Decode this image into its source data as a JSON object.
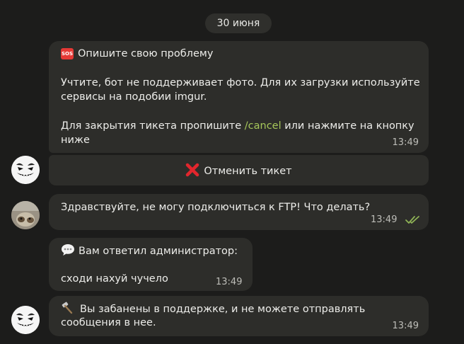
{
  "date_label": "30 июня",
  "messages": {
    "intro": {
      "title": "Опишите свою проблему",
      "line1": "Учтите, бот не поддерживает фото. Для их загрузки используйте",
      "line2": "сервисы на подобии imgur.",
      "line3_prefix": " Для закрытия тикета пропишите ",
      "line3_command": "/cancel",
      "line3_suffix": " или нажмите на кнопку",
      "line4": "ниже",
      "time": "13:49"
    },
    "cancel_button": {
      "label": "Отменить тикет"
    },
    "user_msg": {
      "text": "Здравствуйте, не могу подключиться к FTP! Что делать?",
      "time": "13:49"
    },
    "admin_reply": {
      "title": "Вам ответил администратор:",
      "text": "сходи нахуй чучело",
      "time": "13:49"
    },
    "ban_notice": {
      "line1": "Вы забанены в поддержке, и не можете отправлять",
      "line2": "сообщения в нее.",
      "time": "13:49"
    }
  },
  "colors": {
    "background": "#1c1c1b",
    "bubble": "#2d2d2a",
    "command": "#a6c75a",
    "read_checks": "#8fb356",
    "sos": "#e53935"
  },
  "icons": {
    "sos": "sos-icon",
    "cancel": "cross-mark-icon",
    "speech": "speech-balloon-icon",
    "hammer": "hammer-icon",
    "read": "double-check-icon"
  }
}
